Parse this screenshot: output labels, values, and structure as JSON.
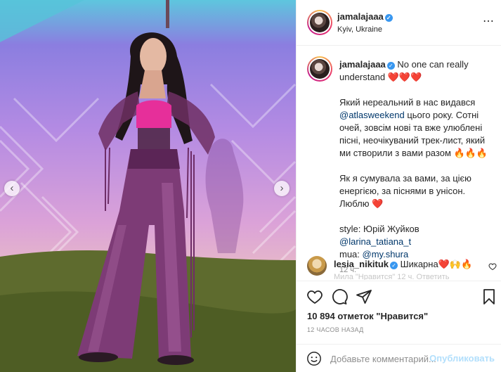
{
  "post": {
    "author": "jamalajaaa",
    "location": "Kyiv, Ukraine",
    "more_icon": "⋯",
    "verified_mark": "✓"
  },
  "caption": {
    "username": "jamalajaaa",
    "first_line": "No one can really understand",
    "hearts": "❤️❤️❤️",
    "para1_before": "Який нереальний в нас видався ",
    "para1_mention": "@atlasweekend",
    "para1_after": " цього року. Сотні очей, зовсім нові та вже улюблені пісні, неочікуваний трек-лист, який ми створили з вами разом ",
    "para1_emoji": "🔥🔥🔥",
    "para2": "Як я сумувала за вами, за цією енергією, за піснями в унісон. Люблю ",
    "para2_emoji": "❤️",
    "style_label": "style: Юрій Жуйков ",
    "style_mention": "@larina_tatiana_t",
    "mua_label": "mua: ",
    "mua_mention": "@my.shura",
    "time": "12 ч."
  },
  "comment": {
    "username": "lesia_nikituk",
    "text": "Шикарна",
    "emoji": "❤️🙌🔥",
    "faded": "Мила  \"Нравится\"  12 ч.  Ответить"
  },
  "actions": {
    "likes": "10 894 отметок \"Нравится\"",
    "time": "12 ЧАСОВ НАЗАД"
  },
  "add_comment": {
    "placeholder": "Добавьте комментарий...",
    "publish_label": "Опубликовать"
  },
  "media": {
    "prev_arrow": "‹",
    "next_arrow": "›"
  },
  "icons": [
    "like-icon",
    "comment-icon",
    "share-icon",
    "save-icon",
    "emoji-icon",
    "more-icon",
    "verified-icon"
  ],
  "colors": {
    "link": "#00376b",
    "heart": "#d81e3c",
    "verified": "#3897f0",
    "publish_disabled": "#b2dffc",
    "muted": "#8e8e8e"
  }
}
